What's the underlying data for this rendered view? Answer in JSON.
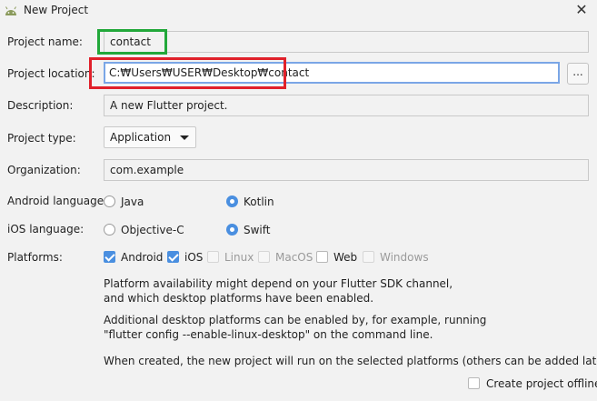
{
  "window": {
    "title": "New Project",
    "close_symbol": "✕",
    "app_icon": "android-icon"
  },
  "form": {
    "project_name": {
      "label": "Project name:",
      "value": "contact"
    },
    "project_location": {
      "label": "Project location:",
      "value": "C:₩Users₩USER₩Desktop₩contact",
      "browse_label": "..."
    },
    "description": {
      "label": "Description:",
      "value": "A new Flutter project."
    },
    "project_type": {
      "label": "Project type:",
      "value": "Application"
    },
    "organization": {
      "label": "Organization:",
      "value": "com.example"
    },
    "android_language": {
      "label": "Android language:",
      "options": [
        "Java",
        "Kotlin"
      ],
      "selected": "Kotlin"
    },
    "ios_language": {
      "label": "iOS language:",
      "options": [
        "Objective-C",
        "Swift"
      ],
      "selected": "Swift"
    },
    "platforms": {
      "label": "Platforms:",
      "items": [
        {
          "label": "Android",
          "checked": true,
          "enabled": true
        },
        {
          "label": "iOS",
          "checked": true,
          "enabled": true
        },
        {
          "label": "Linux",
          "checked": false,
          "enabled": false
        },
        {
          "label": "MacOS",
          "checked": false,
          "enabled": false
        },
        {
          "label": "Web",
          "checked": false,
          "enabled": true
        },
        {
          "label": "Windows",
          "checked": false,
          "enabled": false
        }
      ]
    }
  },
  "info": {
    "line1": "Platform availability might depend on your Flutter SDK channel,",
    "line2": "and which desktop platforms have been enabled.",
    "line3": "Additional desktop platforms can be enabled by, for example, running",
    "line4": "\"flutter config --enable-linux-desktop\" on the command line.",
    "line5": "When created, the new project will run on the selected platforms (others can be added later)."
  },
  "create_offline": {
    "label": "Create project offline",
    "checked": false
  },
  "colors": {
    "accent": "#4a8fe0",
    "highlight_green": "#22a83a",
    "highlight_red": "#e0202a"
  }
}
